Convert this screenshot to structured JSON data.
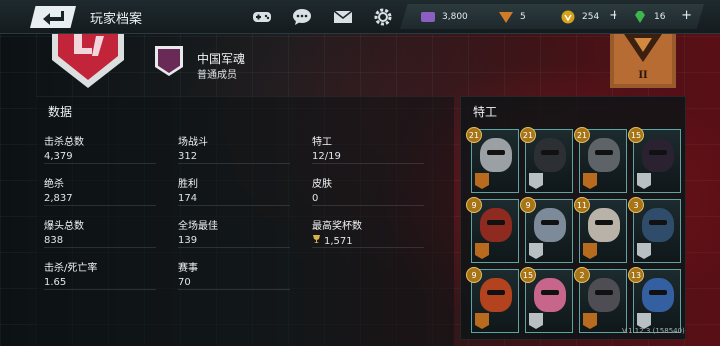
{
  "header": {
    "title": "玩家档案",
    "icons": [
      "gamepad-icon",
      "chat-icon",
      "mail-icon",
      "settings-gear-icon"
    ],
    "currencies": [
      {
        "name": "premium-currency-icon",
        "value": "3,800",
        "color": "#8a5fbf",
        "plus": false
      },
      {
        "name": "tokens-icon",
        "value": "5",
        "color": "#d17b28",
        "plus": false
      },
      {
        "name": "gold-icon",
        "value": "254",
        "color": "#d7a21b",
        "plus": true
      },
      {
        "name": "gem-icon",
        "value": "16",
        "color": "#3fb54e",
        "plus": true
      }
    ]
  },
  "clan": {
    "name": "中国军魂",
    "rank": "普通成员"
  },
  "stats": {
    "title": "数据",
    "items": [
      {
        "label": "击杀总数",
        "value": "4,379"
      },
      {
        "label": "场战斗",
        "value": "312"
      },
      {
        "label": "特工",
        "value": "12/19"
      },
      {
        "label": "绝杀",
        "value": "2,837"
      },
      {
        "label": "胜利",
        "value": "174"
      },
      {
        "label": "皮肤",
        "value": "0"
      },
      {
        "label": "爆头总数",
        "value": "838"
      },
      {
        "label": "全场最佳",
        "value": "139"
      },
      {
        "label": "最高奖杯数",
        "value": "1,571",
        "icon": "trophy-icon"
      },
      {
        "label": "击杀/死亡率",
        "value": "1.65"
      },
      {
        "label": "赛事",
        "value": "70"
      }
    ]
  },
  "agents": {
    "title": "特工",
    "cards": [
      {
        "level": "21",
        "face": "#9aa0a3",
        "rank": "#b86a1f"
      },
      {
        "level": "21",
        "face": "#2c2f33",
        "rank": "#b9c0c4"
      },
      {
        "level": "21",
        "face": "#5e6368",
        "rank": "#b86a1f"
      },
      {
        "level": "15",
        "face": "#2a2230",
        "rank": "#b9c0c4"
      },
      {
        "level": "9",
        "face": "#8e2a20",
        "rank": "#b86a1f"
      },
      {
        "level": "9",
        "face": "#7c8a99",
        "rank": "#b9c0c4"
      },
      {
        "level": "11",
        "face": "#b8b2a8",
        "rank": "#b86a1f"
      },
      {
        "level": "3",
        "face": "#2f4d6a",
        "rank": "#b9c0c4"
      },
      {
        "level": "9",
        "face": "#b3431e",
        "rank": "#b86a1f"
      },
      {
        "level": "15",
        "face": "#c7658a",
        "rank": "#b9c0c4"
      },
      {
        "level": "2",
        "face": "#4d4d53",
        "rank": "#b86a1f"
      },
      {
        "level": "13",
        "face": "#345fa0",
        "rank": "#b9c0c4"
      }
    ]
  },
  "version": "V.1.12.3 (158540)"
}
